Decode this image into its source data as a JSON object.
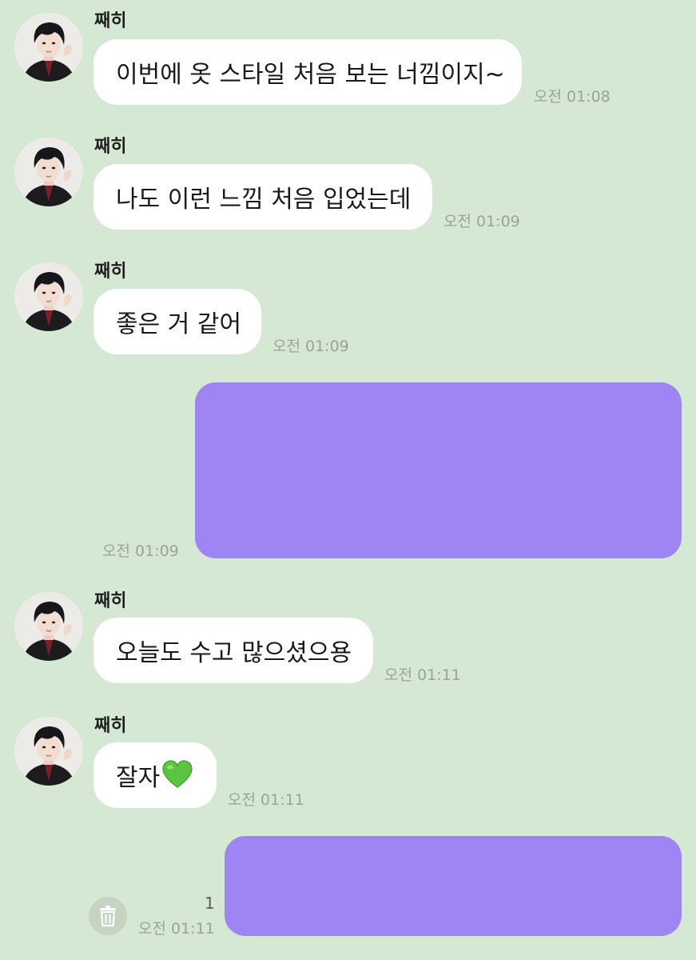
{
  "messages": [
    {
      "sender": "째히",
      "text": "이번에 옷 스타일 처음 보는 너낌이지~",
      "time": "오전 01:08"
    },
    {
      "sender": "째히",
      "text": "나도 이런 느낌 처음 입었는데",
      "time": "오전 01:09"
    },
    {
      "sender": "째히",
      "text": "좋은 거 같어",
      "time": "오전 01:09"
    },
    {
      "sender": "",
      "text": "",
      "time": "오전 01:09"
    },
    {
      "sender": "째히",
      "text": "오늘도 수고 많으셨으용",
      "time": "오전 01:11"
    },
    {
      "sender": "째히",
      "text": "잘자",
      "time": "오전 01:11"
    },
    {
      "sender": "",
      "text": "",
      "time": "오전 01:11",
      "unread": "1"
    }
  ],
  "colors": {
    "background": "#d5e8d3",
    "incoming_bubble": "#ffffff",
    "outgoing_bubble": "#9f85f4",
    "timestamp": "#9aa39a"
  },
  "icons": {
    "heart": "green-heart-icon",
    "trash": "trash-icon"
  }
}
